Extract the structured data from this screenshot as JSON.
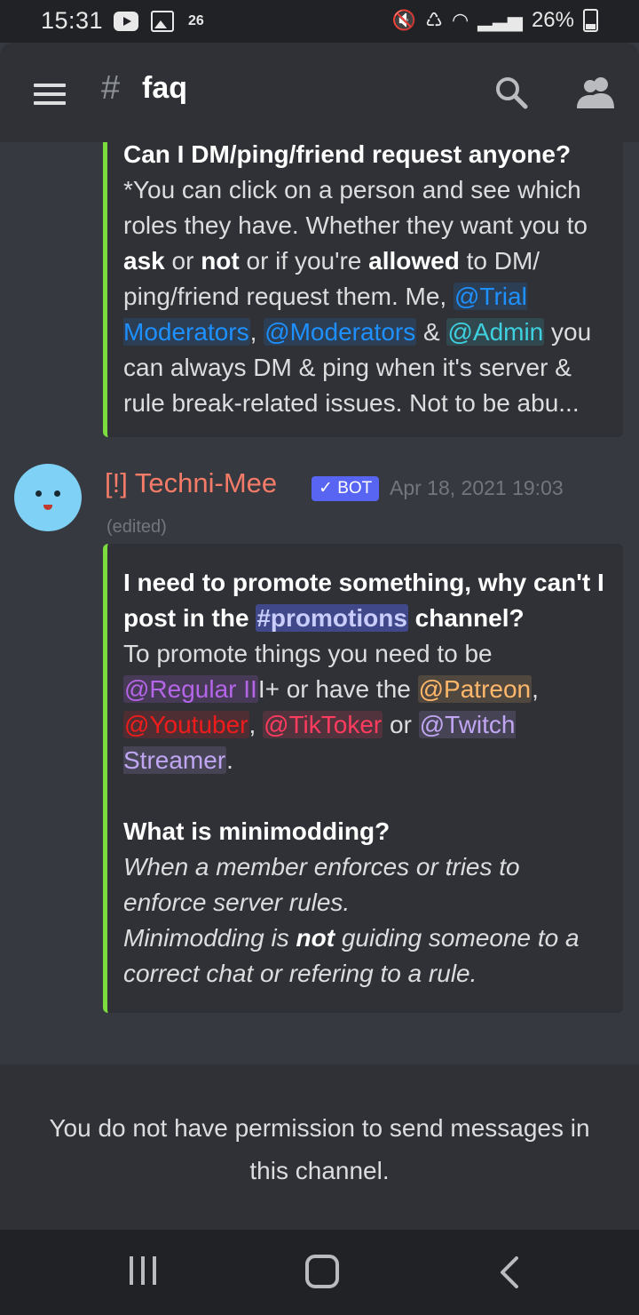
{
  "status_bar": {
    "time": "15:31",
    "notif_count": "26",
    "battery": "26%",
    "icons": [
      "youtube-icon",
      "gallery-icon",
      "mute-icon",
      "battery-saver-icon",
      "wifi-icon",
      "signal-icon",
      "battery-icon"
    ]
  },
  "header": {
    "hash": "#",
    "channel": "faq"
  },
  "embed1": {
    "title": "Can I DM/ping/friend request anyone?",
    "t1": "*You can click on a person and see which roles they have. Whether they want you to ",
    "b1": "ask",
    "t2": " or ",
    "b2": "not",
    "t3": " or if you're ",
    "b3": "allowed",
    "t4": " to DM/ ping/friend request them. Me, ",
    "m1": "@Trial Moderators",
    "t5": ", ",
    "m2": "@Moderators",
    "t6": " & ",
    "m3": "@Admin",
    "t7": " you can always DM & ping when it's server & rule break-related issues. Not to be abu..."
  },
  "message": {
    "author": "[!] Techni-Mee",
    "badge": "✓ BOT",
    "timestamp": "Apr 18, 2021 19:03",
    "edited": "(edited)"
  },
  "embed2": {
    "title_a": "I need to promote something, why can't I post in the ",
    "channel_mention": "#promotions",
    "title_b": " channel?",
    "p1": "To promote things you need to be ",
    "m_regular": "@Regular II",
    "p2": "I+ or have the ",
    "m_patreon": "@Patreon",
    "p3": ", ",
    "m_youtuber": "@Youtuber",
    "p4": ", ",
    "m_tiktoker": "@TikToker",
    "p5": " or ",
    "m_twitch": "@Twitch Streamer",
    "p6": ".",
    "title2": "What is minimodding?",
    "i1": "When a member enforces or tries to enforce server rules.",
    "i2a": "Minimodding is ",
    "i2b": "not",
    "i2c": " guiding someone to a correct chat or refering to a rule."
  },
  "footer": {
    "no_permission": "You do not have permission to send messages in this channel."
  },
  "colors": {
    "background": "#36393f",
    "embed_bg": "#2f3136",
    "embed_border": "#7cdc3e",
    "author": "#f47b67",
    "bot_badge": "#5865f2"
  }
}
